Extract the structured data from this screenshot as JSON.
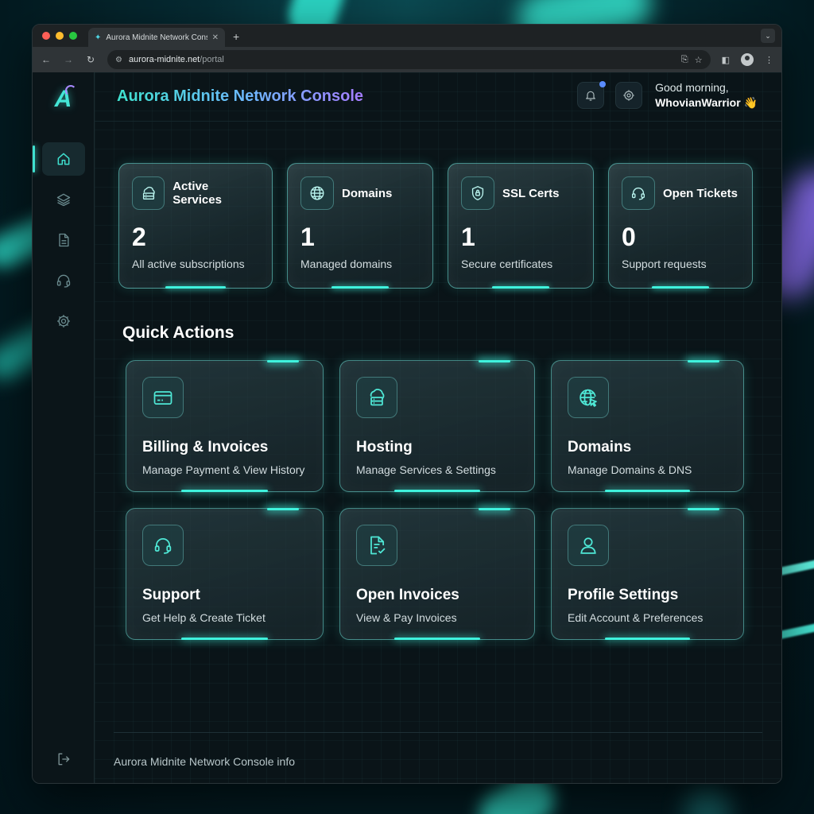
{
  "browser": {
    "tab_title": "Aurora Midnite Network Cons",
    "url_host": "aurora-midnite.net",
    "url_path": "/portal"
  },
  "app": {
    "title": "Aurora Midnite Network Console",
    "greeting_line": "Good morning,",
    "user_name": "WhovianWarrior 👋"
  },
  "sidebar": {
    "items": [
      {
        "name": "home",
        "icon": "home-icon",
        "active": true
      },
      {
        "name": "services",
        "icon": "layers-icon",
        "active": false
      },
      {
        "name": "documents",
        "icon": "document-icon",
        "active": false
      },
      {
        "name": "support",
        "icon": "headset-icon",
        "active": false
      },
      {
        "name": "settings",
        "icon": "gear-icon",
        "active": false
      }
    ]
  },
  "stats": [
    {
      "label": "Active Services",
      "value": "2",
      "sub": "All active subscriptions",
      "icon": "cloud-server-icon"
    },
    {
      "label": "Domains",
      "value": "1",
      "sub": "Managed domains",
      "icon": "globe-icon"
    },
    {
      "label": "SSL Certs",
      "value": "1",
      "sub": "Secure certificates",
      "icon": "shield-lock-icon"
    },
    {
      "label": "Open Tickets",
      "value": "0",
      "sub": "Support requests",
      "icon": "headset-icon"
    }
  ],
  "quick_actions": {
    "title": "Quick Actions",
    "items": [
      {
        "title": "Billing & Invoices",
        "sub": "Manage Payment & View History",
        "icon": "credit-card-icon"
      },
      {
        "title": "Hosting",
        "sub": "Manage Services & Settings",
        "icon": "cloud-server-icon"
      },
      {
        "title": "Domains",
        "sub": "Manage Domains & DNS",
        "icon": "globe-cursor-icon"
      },
      {
        "title": "Support",
        "sub": "Get Help & Create Ticket",
        "icon": "headset-icon"
      },
      {
        "title": "Open Invoices",
        "sub": "View & Pay Invoices",
        "icon": "document-check-icon"
      },
      {
        "title": "Profile Settings",
        "sub": "Edit Account & Preferences",
        "icon": "user-icon"
      }
    ]
  },
  "footer": {
    "text": "Aurora Midnite Network Console info"
  },
  "colors": {
    "accent": "#3fe0cf",
    "accent_purple": "#a57cff",
    "background": "#0a1418"
  }
}
